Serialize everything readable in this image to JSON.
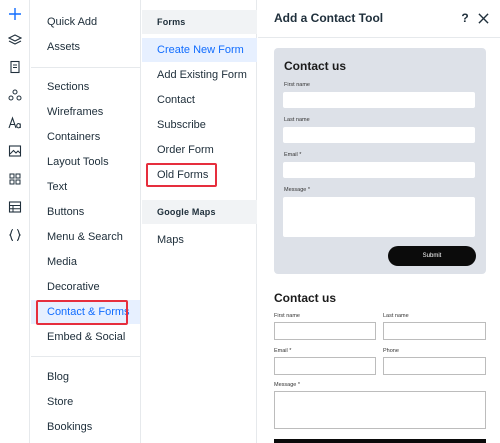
{
  "rail_icons": [
    "add-icon",
    "layers-icon",
    "page-icon",
    "nodes-icon",
    "text-style-icon",
    "image-icon",
    "apps-icon",
    "table-icon",
    "code-icon"
  ],
  "categories": [
    "Quick Add",
    "Assets",
    "Sections",
    "Wireframes",
    "Containers",
    "Layout Tools",
    "Text",
    "Buttons",
    "Menu & Search",
    "Media",
    "Decorative",
    "Contact & Forms",
    "Embed & Social",
    "Blog",
    "Store",
    "Bookings"
  ],
  "sub": {
    "forms_heading": "Forms",
    "forms_items": [
      "Create New Form",
      "Add Existing Form",
      "Contact",
      "Subscribe",
      "Order Form",
      "Old Forms"
    ],
    "maps_heading": "Google Maps",
    "maps_items": [
      "Maps"
    ]
  },
  "panel": {
    "title": "Add a Contact Tool",
    "help": "?",
    "card1": {
      "title": "Contact us",
      "first_name": "First name",
      "last_name": "Last name",
      "email": "Email *",
      "message": "Message *",
      "submit": "Submit"
    },
    "card2": {
      "title": "Contact us",
      "first_name": "First name",
      "last_name": "Last name",
      "email": "Email *",
      "phone": "Phone",
      "message": "Message *"
    }
  },
  "colors": {
    "accent": "#116dff",
    "highlight_box": "#e62e3d",
    "selected_bg": "#e7f0ff"
  }
}
